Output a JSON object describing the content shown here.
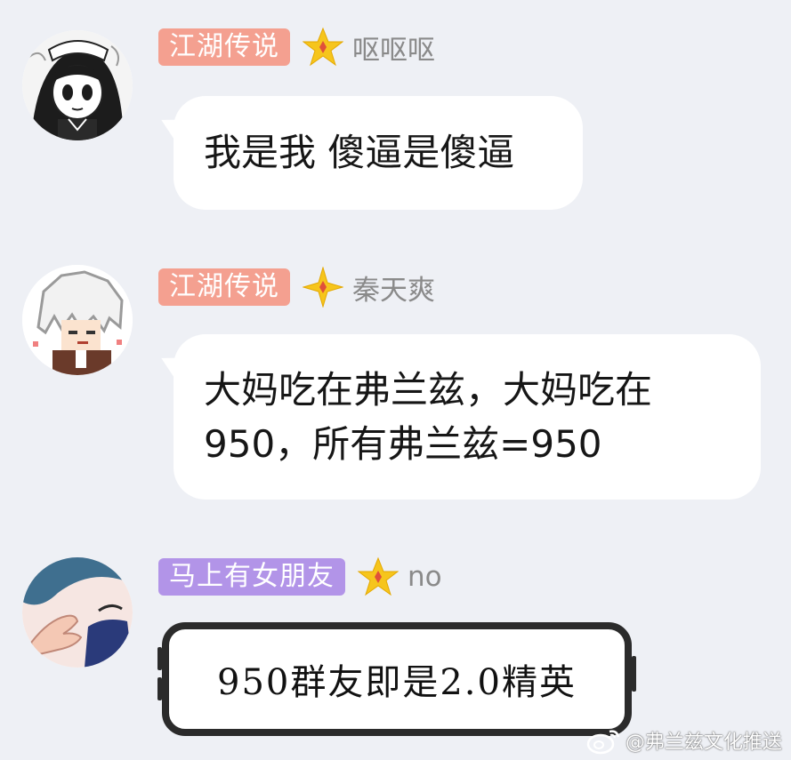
{
  "colors": {
    "background": "#eef0f5",
    "title_badge_salmon": "#f4a090",
    "title_badge_purple": "#b294e8",
    "nickname_gray": "#8a8a8a",
    "star_gold": "#f6c51c"
  },
  "messages": [
    {
      "title": "江湖传说",
      "nickname": "呕呕呕",
      "text": "我是我 傻逼是傻逼",
      "icons": [
        "manga-girl-avatar",
        "star-icon"
      ]
    },
    {
      "title": "江湖传说",
      "nickname": "秦天爽",
      "text_line1": "大妈吃在弗兰兹，大妈吃在",
      "text_line2": "950，所有弗兰兹=950",
      "icons": [
        "pixel-white-hair-avatar",
        "star-icon"
      ]
    },
    {
      "title": "马上有女朋友",
      "nickname": "no",
      "text": "950群友即是2.0精英",
      "icons": [
        "anime-hand-avatar",
        "star-icon"
      ]
    }
  ],
  "watermark": {
    "text": "@弗兰兹文化推送",
    "icon": "weibo-icon"
  }
}
